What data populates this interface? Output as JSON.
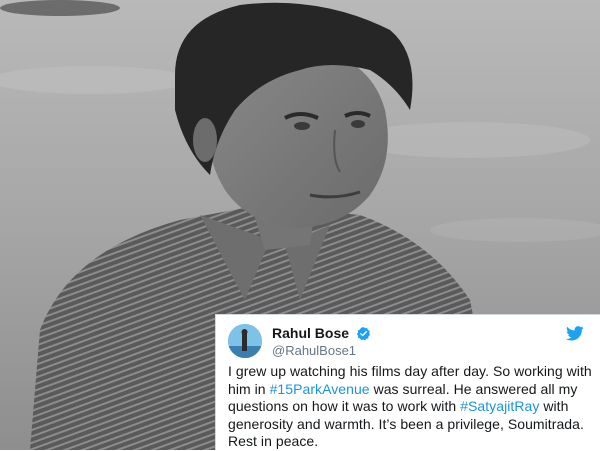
{
  "photo": {
    "description_icon": "portrait-photo"
  },
  "tweet": {
    "display_name": "Rahul Bose",
    "handle": "@RahulBose1",
    "verified": true,
    "brand_icon": "twitter-bird-icon",
    "text_parts": {
      "p1": "I grew up watching his films day after day. So working with him in ",
      "hashtag1": "#15ParkAvenue",
      "p2": " was surreal. He answered all my questions on how it was to work with ",
      "hashtag2": "#SatyajitRay",
      "p3": " with generosity and warmth. It’s been a privilege, Soumitrada. Rest in peace."
    },
    "colors": {
      "hashtag": "#1b95e0",
      "verified": "#1da1f2",
      "twitter_brand": "#1da1f2"
    }
  }
}
